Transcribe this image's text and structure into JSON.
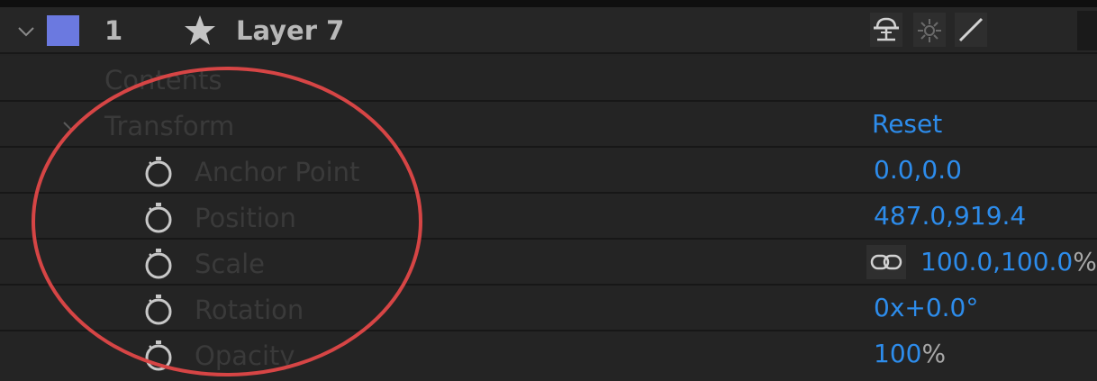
{
  "layer": {
    "index": "1",
    "name": "Layer 7",
    "label_color": "#6b79e0",
    "expand_icon": "chevron-down-icon",
    "star_icon": "star-icon",
    "switches": [
      "shy-icon",
      "collapse-transform-icon",
      "quality-icon"
    ]
  },
  "contents": {
    "label": "Contents"
  },
  "transform": {
    "label": "Transform",
    "reset_label": "Reset"
  },
  "properties": [
    {
      "name": "Anchor Point",
      "value": "0.0,0.0",
      "unit": ""
    },
    {
      "name": "Position",
      "value": "487.0,919.4",
      "unit": ""
    },
    {
      "name": "Scale",
      "value": "100.0,100.0",
      "unit": "%"
    },
    {
      "name": "Rotation",
      "value": "0x+0.0°",
      "unit": ""
    },
    {
      "name": "Opacity",
      "value": "100",
      "unit": "%"
    }
  ],
  "colors": {
    "value_blue": "#2d8ceb",
    "annotation_red": "#d64545",
    "background": "#232323"
  }
}
